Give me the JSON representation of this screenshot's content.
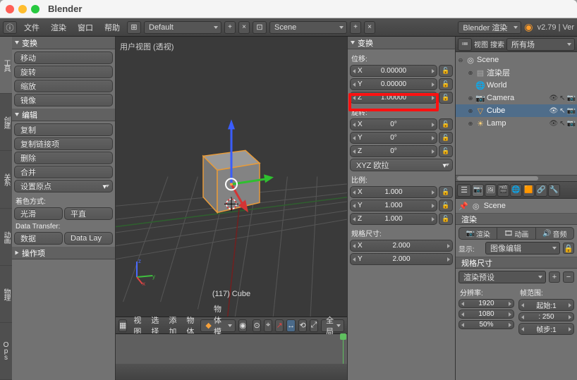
{
  "titlebar": {
    "app": "Blender"
  },
  "topbar": {
    "menus": [
      "文件",
      "渲染",
      "窗口",
      "帮助"
    ],
    "layout": "Default",
    "scene": "Scene",
    "engine": "Blender 渲染",
    "version": "v2.79 | Ver"
  },
  "spine_tabs": [
    "工具",
    "创建",
    "关系",
    "动画",
    "物理",
    "Ops"
  ],
  "toolshelf": {
    "transform": {
      "title": "变换",
      "items": [
        "移动",
        "旋转",
        "缩放",
        "镜像"
      ]
    },
    "edit": {
      "title": "编辑",
      "items": [
        "复制",
        "复制链接项",
        "删除",
        "合并"
      ],
      "origin": "设置原点"
    },
    "shading_label": "着色方式:",
    "shading": [
      "光滑",
      "平直"
    ],
    "data_transfer_label": "Data Transfer:",
    "data_transfer_btns": [
      "数据",
      "Data Lay"
    ],
    "ops_panel": "操作项"
  },
  "viewport": {
    "label": "用户视图 (透视)",
    "object": "(117) Cube",
    "header": {
      "menus": [
        "视图",
        "选择",
        "添加",
        "物体"
      ],
      "mode": "物体模式",
      "orientation": "全局"
    }
  },
  "npanel": {
    "title": "变换",
    "location_label": "位移:",
    "loc": [
      {
        "axis": "X",
        "val": "0.00000"
      },
      {
        "axis": "Y",
        "val": "0.00000"
      },
      {
        "axis": "Z",
        "val": "1.00000"
      }
    ],
    "rotation_label": "旋转:",
    "rot": [
      {
        "axis": "X",
        "val": "0°"
      },
      {
        "axis": "Y",
        "val": "0°"
      },
      {
        "axis": "Z",
        "val": "0°"
      }
    ],
    "rot_mode": "XYZ 欧拉",
    "scale_label": "比例:",
    "scale": [
      {
        "axis": "X",
        "val": "1.000"
      },
      {
        "axis": "Y",
        "val": "1.000"
      },
      {
        "axis": "Z",
        "val": "1.000"
      }
    ],
    "dim_label": "规格尺寸:",
    "dim": [
      {
        "axis": "X",
        "val": "2.000"
      },
      {
        "axis": "Y",
        "val": "2.000"
      }
    ]
  },
  "outliner": {
    "header": {
      "view": "视图",
      "search": "搜索",
      "all": "所有场"
    },
    "scene": "Scene",
    "items": [
      {
        "name": "渲染层",
        "kind": "layer"
      },
      {
        "name": "World",
        "kind": "world"
      },
      {
        "name": "Camera",
        "kind": "cam"
      },
      {
        "name": "Cube",
        "kind": "mesh"
      },
      {
        "name": "Lamp",
        "kind": "lamp"
      }
    ]
  },
  "props": {
    "crumb": "Scene",
    "render_panel": "渲染",
    "render_buttons": [
      "渲染",
      "动画",
      "音频"
    ],
    "display_label": "显示:",
    "display_value": "图像编辑",
    "dim_panel": "规格尺寸",
    "preset": "渲染预设",
    "res_label": "分辨率:",
    "res_x": "1920",
    "res_y": "1080",
    "res_pct": "50%",
    "frame_label": "帧范围:",
    "frame_start": "起始:1",
    "frame_end": ": 250",
    "frame_step": "帧步:1"
  }
}
